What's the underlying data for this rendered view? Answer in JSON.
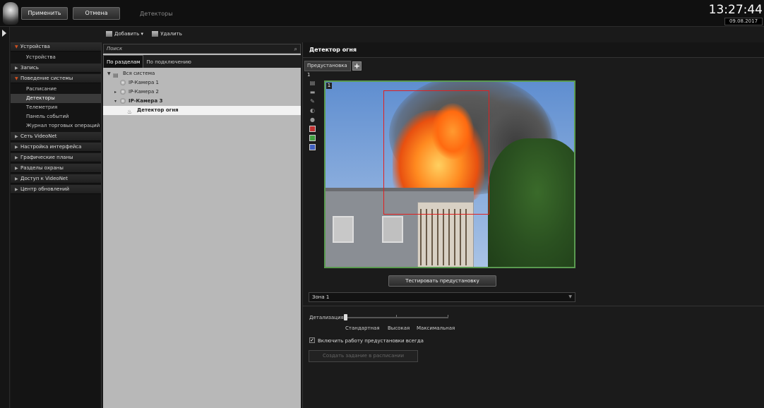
{
  "topbar": {
    "apply_label": "Применить",
    "cancel_label": "Отмена",
    "breadcrumb": "Детекторы",
    "time": "13:27:44",
    "date": "09.08.2017"
  },
  "toolbar": {
    "add_label": "Добавить",
    "delete_label": "Удалить"
  },
  "sidebar": {
    "groups": [
      {
        "label": "Устройства",
        "open": true,
        "items": [
          "Устройства"
        ]
      },
      {
        "label": "Запись",
        "open": false,
        "items": []
      },
      {
        "label": "Поведение системы",
        "open": true,
        "items": [
          "Расписание",
          "Детекторы",
          "Телеметрия",
          "Панель событий",
          "Журнал торговых операций"
        ]
      },
      {
        "label": "Сеть VideoNet",
        "open": false,
        "items": []
      },
      {
        "label": "Настройка интерфейса",
        "open": false,
        "items": []
      },
      {
        "label": "Графические планы",
        "open": false,
        "items": []
      },
      {
        "label": "Разделы охраны",
        "open": false,
        "items": []
      },
      {
        "label": "Доступ к VideoNet",
        "open": false,
        "items": []
      },
      {
        "label": "Центр обновлений",
        "open": false,
        "items": []
      }
    ],
    "active_item": "Детекторы"
  },
  "tree_panel": {
    "search_placeholder": "Поиск",
    "tabs": [
      "По разделам",
      "По подключению"
    ],
    "active_tab": "По разделам",
    "nodes": [
      {
        "label": "Вся система",
        "level": 0
      },
      {
        "label": "IP-Камера 1",
        "level": 1
      },
      {
        "label": "IP-Камера 2",
        "level": 1
      },
      {
        "label": "IP-Камера 3",
        "level": 1
      },
      {
        "label": "Детектор огня",
        "level": 2
      }
    ]
  },
  "detector": {
    "title": "Детектор огня",
    "preset_tab": "Предустановка 1",
    "preset_add": "+",
    "video_number": "1",
    "test_button": "Тестировать предустановку",
    "zone_select": "Зона 1",
    "detail_label": "Детализация:",
    "levels": [
      "Стандартная",
      "Высокая",
      "Максимальная"
    ],
    "checkbox_label": "Включить работу предустановки всегда",
    "checkbox_checked": true,
    "schedule_button": "Создать задание в расписании"
  },
  "colors": {
    "zone_border": "#e02020",
    "video_border": "#5a9a50",
    "tree_bg": "#b8b8b8"
  }
}
